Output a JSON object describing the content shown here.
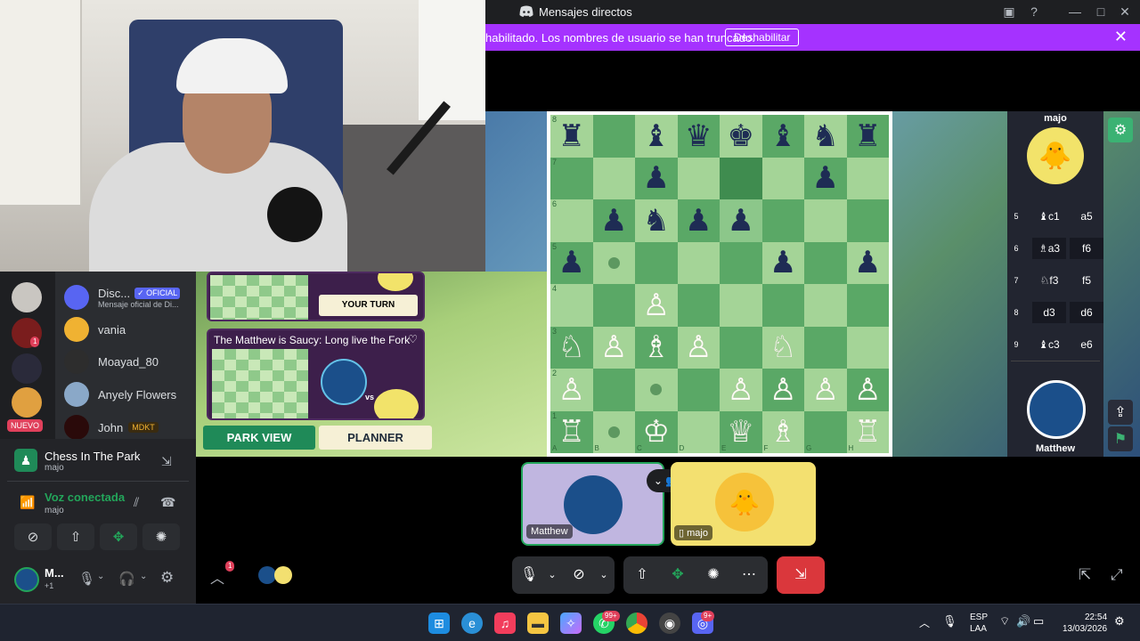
{
  "window": {
    "title": "Mensajes directos"
  },
  "banner": {
    "text": "habilitado. Los nombres de usuario se han truncado.",
    "button_label": "Deshabilitar"
  },
  "game": {
    "opponent_name": "majo",
    "player_name": "Matthew",
    "board": [
      [
        "♜",
        "",
        "♝",
        "♛",
        "♚",
        "♝",
        "♞",
        "♜"
      ],
      [
        "",
        "",
        "♟",
        "",
        "",
        "",
        "♟",
        ""
      ],
      [
        "",
        "♟",
        "♞",
        "♟",
        "♟",
        "",
        "",
        ""
      ],
      [
        "♟",
        "",
        "",
        "",
        "",
        "♟",
        "",
        "♟"
      ],
      [
        "",
        "",
        "♙",
        "",
        "",
        "",
        "",
        ""
      ],
      [
        "♘",
        "♙",
        "♗",
        "♙",
        "",
        "♘",
        "",
        ""
      ],
      [
        "♙",
        "",
        "",
        "",
        "♙",
        "♙",
        "♙",
        "♙"
      ],
      [
        "♖",
        "",
        "♔",
        "",
        "♕",
        "♗",
        "",
        "♖"
      ]
    ],
    "ranks": [
      "8",
      "7",
      "6",
      "5",
      "4",
      "3",
      "2",
      "1"
    ],
    "files": [
      "A",
      "B",
      "C",
      "D",
      "E",
      "F",
      "G",
      "H"
    ],
    "moves": [
      {
        "n": "5",
        "w": "♝c1",
        "b": "a5"
      },
      {
        "n": "6",
        "w": "♗a3",
        "b": "f6"
      },
      {
        "n": "7",
        "w": "♘f3",
        "b": "f5"
      },
      {
        "n": "8",
        "w": "d3",
        "b": "d6"
      },
      {
        "n": "9",
        "w": "♝c3",
        "b": "e6"
      }
    ],
    "card1_button": "YOUR TURN",
    "card2_title": "The Matthew is Saucy: Long live the Fork",
    "vs_label": "vs",
    "tab_park": "PARK VIEW",
    "tab_planner": "PLANNER"
  },
  "sidebar": {
    "badge_count": "1",
    "new_label": "NUEVO",
    "dms": [
      {
        "name": "Disc...",
        "tag": "✓ OFICIAL",
        "subtitle": "Mensaje oficial de Di..."
      },
      {
        "name": "vania"
      },
      {
        "name": "Moayad_80"
      },
      {
        "name": "Anyely Flowers"
      },
      {
        "name": "John",
        "tag": "MDKT"
      }
    ]
  },
  "voice": {
    "activity_name": "Chess In The Park",
    "activity_sub": "majo",
    "status": "Voz conectada",
    "status_sub": "majo"
  },
  "user": {
    "name": "M...",
    "sub": "+1"
  },
  "call": {
    "tile1_name": "Matthew",
    "tile2_name": "majo",
    "notif_count": "1"
  },
  "taskbar": {
    "lang1": "ESP",
    "lang2": "LAA",
    "time": "22:54",
    "date": "13/03/2026",
    "whatsapp_badge": "99+",
    "discord_badge": "9+"
  },
  "colors": {
    "accent": "#a532ff",
    "board_light": "#a4d497",
    "board_dark": "#5aa866",
    "voice_green": "#23a55a",
    "leave_red": "#da373c"
  }
}
